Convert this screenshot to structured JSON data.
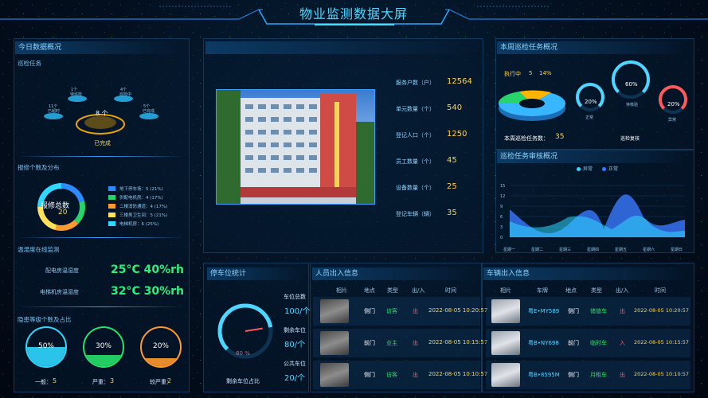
{
  "title": "物业监测数据大屏",
  "today": {
    "title": "今日数据概况",
    "inspection_task_label": "巡检任务",
    "nodes": [
      {
        "count": "1个",
        "label": "待巡检"
      },
      {
        "count": "4个",
        "label": "巡检中"
      },
      {
        "count": "11个",
        "label": "已超时"
      },
      {
        "count": "5个",
        "label": "已完成"
      }
    ],
    "center_count": "8 个",
    "center_label": "已完成",
    "repair_title": "报修个数及分布",
    "repair_total_label": "报修总数",
    "repair_total": "20",
    "repair_items": [
      {
        "label": "地下停车场：5 (21%)",
        "color": "#2e8bff"
      },
      {
        "label": "供配电机房：4 (17%)",
        "color": "#27d36a"
      },
      {
        "label": "二楼消防通道：4 (17%)",
        "color": "#ff9a2e"
      },
      {
        "label": "三楼男卫生间：5 (21%)",
        "color": "#ffe25a"
      },
      {
        "label": "电梯机房：6 (25%)",
        "color": "#2fd8ff"
      }
    ],
    "temp_title": "温湿度在线监测",
    "temp_rows": [
      {
        "label": "配电房温湿度",
        "value": "25°C  40%rh"
      },
      {
        "label": "电梯机房温湿度",
        "value": "32°C  30%rh"
      }
    ],
    "hazard_title": "隐患等级个数及占比",
    "hazards": [
      {
        "pct": "50%",
        "label": "一般：",
        "count": "5",
        "color": "#2fd8ff",
        "fill": 0.5
      },
      {
        "pct": "30%",
        "label": "严重：",
        "count": "3",
        "color": "#27e06a",
        "fill": 0.3
      },
      {
        "pct": "20%",
        "label": "较严重：",
        "count": "2",
        "color": "#ff9a2e",
        "fill": 0.2
      }
    ]
  },
  "property": {
    "stats": [
      {
        "label": "服务户数（户）",
        "value": "12564"
      },
      {
        "label": "单元数量（个）",
        "value": "540"
      },
      {
        "label": "登记人口（个）",
        "value": "1250"
      },
      {
        "label": "员工数量（个）",
        "value": "45"
      },
      {
        "label": "设备数量（个）",
        "value": "25"
      },
      {
        "label": "登记车辆（辆）",
        "value": "35"
      }
    ]
  },
  "weekly": {
    "title": "本周巡检任务概况",
    "in_progress_label": "执行中",
    "in_progress_count": "5",
    "in_progress_pct": "14%",
    "gauges": [
      {
        "pct": "20%",
        "label": "正常",
        "color": "#4fd6ff",
        "value": 20
      },
      {
        "pct": "60%",
        "label": "待核验",
        "color": "#4fd6ff",
        "value": 60
      },
      {
        "pct": "20%",
        "label": "异常",
        "color": "#ff5a5a",
        "value": 20
      }
    ],
    "total_label": "本周巡检任务数：",
    "total_value": "35",
    "review_label": "巡检复核"
  },
  "review": {
    "title": "巡检任务审核概况",
    "legend": [
      {
        "name": "异常",
        "color": "#2fd8ff"
      },
      {
        "name": "正常",
        "color": "#3a78ff"
      }
    ],
    "yticks": [
      "15",
      "12",
      "9",
      "6",
      "3",
      "0"
    ],
    "xticks": [
      "星期一",
      "星期二",
      "星期三",
      "星期四",
      "星期五",
      "星期六",
      "星期日"
    ]
  },
  "parking": {
    "title": "停车位统计",
    "gauge_pct": "80 %",
    "gauge_label": "剩余车位占比",
    "gauge_value": 80,
    "stats": [
      {
        "label": "车位总数",
        "value": "100/个"
      },
      {
        "label": "剩余车位",
        "value": "80/个"
      },
      {
        "label": "公共车位",
        "value": "20/个"
      }
    ]
  },
  "people": {
    "title": "人员出入信息",
    "headers": [
      "相片",
      "地点",
      "类型",
      "出/入",
      "时间"
    ],
    "rows": [
      {
        "place": "侧门",
        "type": "访客",
        "dir": "出",
        "time": "2022-08-05 10:20:57"
      },
      {
        "place": "前门",
        "type": "业主",
        "dir": "出",
        "time": "2022-08-05 10:15:57"
      },
      {
        "place": "侧门",
        "type": "访客",
        "dir": "出",
        "time": "2022-08-05 10:10:57"
      }
    ]
  },
  "vehicles": {
    "title": "车辆出入信息",
    "headers": [
      "相片",
      "车牌",
      "地点",
      "类型",
      "出/入",
      "时间"
    ],
    "rows": [
      {
        "plate": "粤E•MY589",
        "place": "侧门",
        "type": "储值车",
        "dir": "出",
        "time": "2022-08-05 10:20:57"
      },
      {
        "plate": "粤B•NY698",
        "place": "前门",
        "type": "临时车",
        "dir": "入",
        "time": "2022-08-05 10:15:57"
      },
      {
        "plate": "粤B•8595M",
        "place": "侧门",
        "type": "月租车",
        "dir": "出",
        "time": "2022-08-05 10:10:57"
      }
    ]
  }
}
